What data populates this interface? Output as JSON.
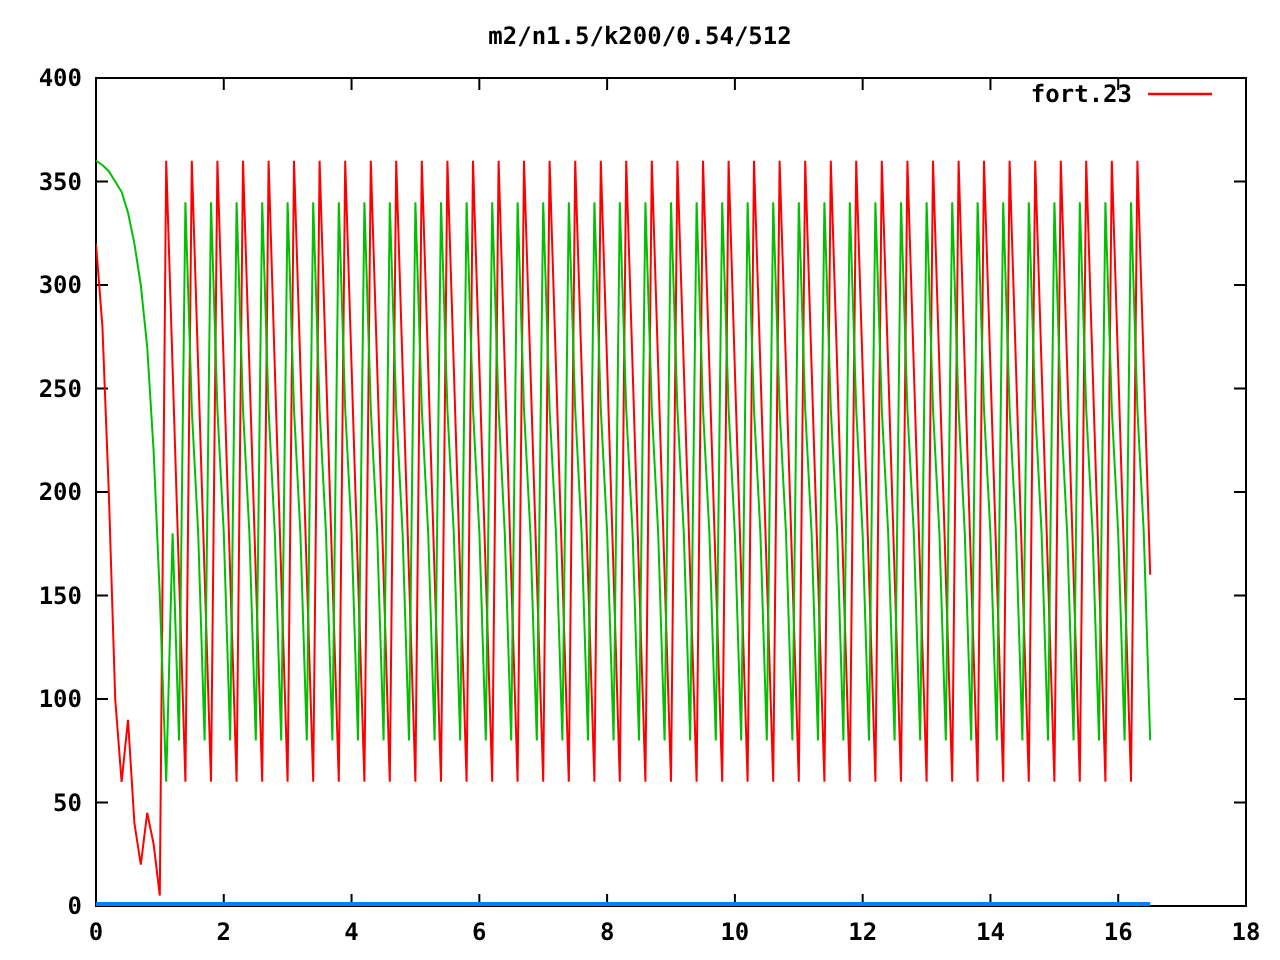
{
  "chart_data": {
    "type": "line",
    "title": "m2/n1.5/k200/0.54/512",
    "xlim": [
      0,
      18
    ],
    "ylim": [
      0,
      400
    ],
    "xticks": [
      0,
      2,
      4,
      6,
      8,
      10,
      12,
      14,
      16,
      18
    ],
    "yticks": [
      0,
      50,
      100,
      150,
      200,
      250,
      300,
      350,
      400
    ],
    "x": [
      0,
      0.1,
      0.2,
      0.3,
      0.4,
      0.5,
      0.6,
      0.7,
      0.8,
      0.9,
      1,
      1.1,
      1.2,
      1.3,
      1.4,
      1.5,
      1.6,
      1.7,
      1.8,
      1.9,
      2,
      2.1,
      2.2,
      2.3,
      2.4,
      2.5,
      2.6,
      2.7,
      2.8,
      2.9,
      3,
      3.1,
      3.2,
      3.3,
      3.4,
      3.5,
      3.6,
      3.7,
      3.8,
      3.9,
      4,
      4.1,
      4.2,
      4.3,
      4.4,
      4.5,
      4.6,
      4.7,
      4.8,
      4.9,
      5,
      5.1,
      5.2,
      5.3,
      5.4,
      5.5,
      5.6,
      5.7,
      5.8,
      5.9,
      6,
      6.1,
      6.2,
      6.3,
      6.4,
      6.5,
      6.6,
      6.7,
      6.8,
      6.9,
      7,
      7.1,
      7.2,
      7.3,
      7.4,
      7.5,
      7.6,
      7.7,
      7.8,
      7.9,
      8,
      8.1,
      8.2,
      8.3,
      8.4,
      8.5,
      8.6,
      8.7,
      8.8,
      8.9,
      9,
      9.1,
      9.2,
      9.3,
      9.4,
      9.5,
      9.6,
      9.7,
      9.8,
      9.9,
      10,
      10.1,
      10.2,
      10.3,
      10.4,
      10.5,
      10.6,
      10.7,
      10.8,
      10.9,
      11,
      11.1,
      11.2,
      11.3,
      11.4,
      11.5,
      11.6,
      11.7,
      11.8,
      11.9,
      12,
      12.1,
      12.2,
      12.3,
      12.4,
      12.5,
      12.6,
      12.7,
      12.8,
      12.9,
      13,
      13.1,
      13.2,
      13.3,
      13.4,
      13.5,
      13.6,
      13.7,
      13.8,
      13.9,
      14,
      14.1,
      14.2,
      14.3,
      14.4,
      14.5,
      14.6,
      14.7,
      14.8,
      14.9,
      15,
      15.1,
      15.2,
      15.3,
      15.4,
      15.5,
      15.6,
      15.7,
      15.8,
      15.9,
      16,
      16.1,
      16.2,
      16.3,
      16.4,
      16.5
    ],
    "series": [
      {
        "name": "fort.23",
        "color": "#ff0000",
        "values": [
          320,
          280,
          200,
          100,
          60,
          90,
          40,
          20,
          45,
          30,
          5,
          360,
          260,
          160,
          60,
          360,
          260,
          160,
          60,
          360,
          260,
          160,
          60,
          360,
          260,
          160,
          60,
          360,
          260,
          160,
          60,
          360,
          260,
          160,
          60,
          360,
          260,
          160,
          60,
          360,
          260,
          160,
          60,
          360,
          260,
          160,
          60,
          360,
          260,
          160,
          60,
          360,
          260,
          160,
          60,
          360,
          260,
          160,
          60,
          360,
          260,
          160,
          60,
          360,
          260,
          160,
          60,
          360,
          260,
          160,
          60,
          360,
          260,
          160,
          60,
          360,
          260,
          160,
          60,
          360,
          260,
          160,
          60,
          360,
          260,
          160,
          60,
          360,
          260,
          160,
          60,
          360,
          260,
          160,
          60,
          360,
          260,
          160,
          60,
          360,
          260,
          160,
          60,
          360,
          260,
          160,
          60,
          360,
          260,
          160,
          60,
          360,
          260,
          160,
          60,
          360,
          260,
          160,
          60,
          360,
          260,
          160,
          60,
          360,
          260,
          160,
          60,
          360,
          260,
          160,
          60,
          360,
          260,
          160,
          60,
          360,
          260,
          160,
          60,
          360,
          260,
          160,
          60,
          360,
          260,
          160,
          60,
          360,
          260,
          160,
          60,
          360,
          260,
          160,
          60,
          360,
          260,
          160,
          60,
          360,
          260,
          160,
          60,
          360,
          260,
          160
        ]
      },
      {
        "color": "#00c000",
        "values": [
          360,
          358,
          355,
          350,
          345,
          335,
          320,
          300,
          270,
          220,
          150,
          60,
          180,
          80,
          340,
          240,
          180,
          80,
          340,
          240,
          180,
          80,
          340,
          240,
          180,
          80,
          340,
          240,
          180,
          80,
          340,
          240,
          180,
          80,
          340,
          240,
          180,
          80,
          340,
          240,
          180,
          80,
          340,
          240,
          180,
          80,
          340,
          240,
          180,
          80,
          340,
          240,
          180,
          80,
          340,
          240,
          180,
          80,
          340,
          240,
          180,
          80,
          340,
          240,
          180,
          80,
          340,
          240,
          180,
          80,
          340,
          240,
          180,
          80,
          340,
          240,
          180,
          80,
          340,
          240,
          180,
          80,
          340,
          240,
          180,
          80,
          340,
          240,
          180,
          80,
          340,
          240,
          180,
          80,
          340,
          240,
          180,
          80,
          340,
          240,
          180,
          80,
          340,
          240,
          180,
          80,
          340,
          240,
          180,
          80,
          340,
          240,
          180,
          80,
          340,
          240,
          180,
          80,
          340,
          240,
          180,
          80,
          340,
          240,
          180,
          80,
          340,
          240,
          180,
          80,
          340,
          240,
          180,
          80,
          340,
          240,
          180,
          80,
          340,
          240,
          180,
          80,
          340,
          240,
          180,
          80,
          340,
          240,
          180,
          80,
          340,
          240,
          180,
          80,
          340,
          240,
          180,
          80,
          340,
          240,
          180,
          80,
          340,
          240,
          180,
          80
        ]
      },
      {
        "color": "#0080ff",
        "values": [
          0,
          0,
          0,
          0,
          0,
          0,
          0,
          0,
          0,
          0,
          0,
          0,
          0,
          0,
          0,
          0,
          0,
          0,
          0,
          0,
          0,
          0,
          0,
          0,
          0,
          0,
          0,
          0,
          0,
          0,
          0,
          0,
          0,
          0,
          0,
          0,
          0,
          0,
          0,
          0,
          0,
          0,
          0,
          0,
          0,
          0,
          0,
          0,
          0,
          0,
          0,
          0,
          0,
          0,
          0,
          0,
          0,
          0,
          0,
          0,
          0,
          0,
          0,
          0,
          0,
          0,
          0,
          0,
          0,
          0,
          0,
          0,
          0,
          0,
          0,
          0,
          0,
          0,
          0,
          0,
          0,
          0,
          0,
          0,
          0,
          0,
          0,
          0,
          0,
          0,
          0,
          0,
          0,
          0,
          0,
          0,
          0,
          0,
          0,
          0,
          0,
          0,
          0,
          0,
          0,
          0,
          0,
          0,
          0,
          0,
          0,
          0,
          0,
          0,
          0,
          0,
          0,
          0,
          0,
          0,
          0,
          0,
          0,
          0,
          0,
          0,
          0,
          0,
          0,
          0,
          0,
          0,
          0,
          0,
          0,
          0,
          0,
          0,
          0,
          0,
          0,
          0,
          0,
          0,
          0,
          0,
          0,
          0,
          0,
          0,
          0,
          0,
          0,
          0,
          0,
          0,
          0,
          0,
          0,
          0,
          0,
          0,
          0,
          0,
          0,
          0
        ]
      }
    ]
  }
}
